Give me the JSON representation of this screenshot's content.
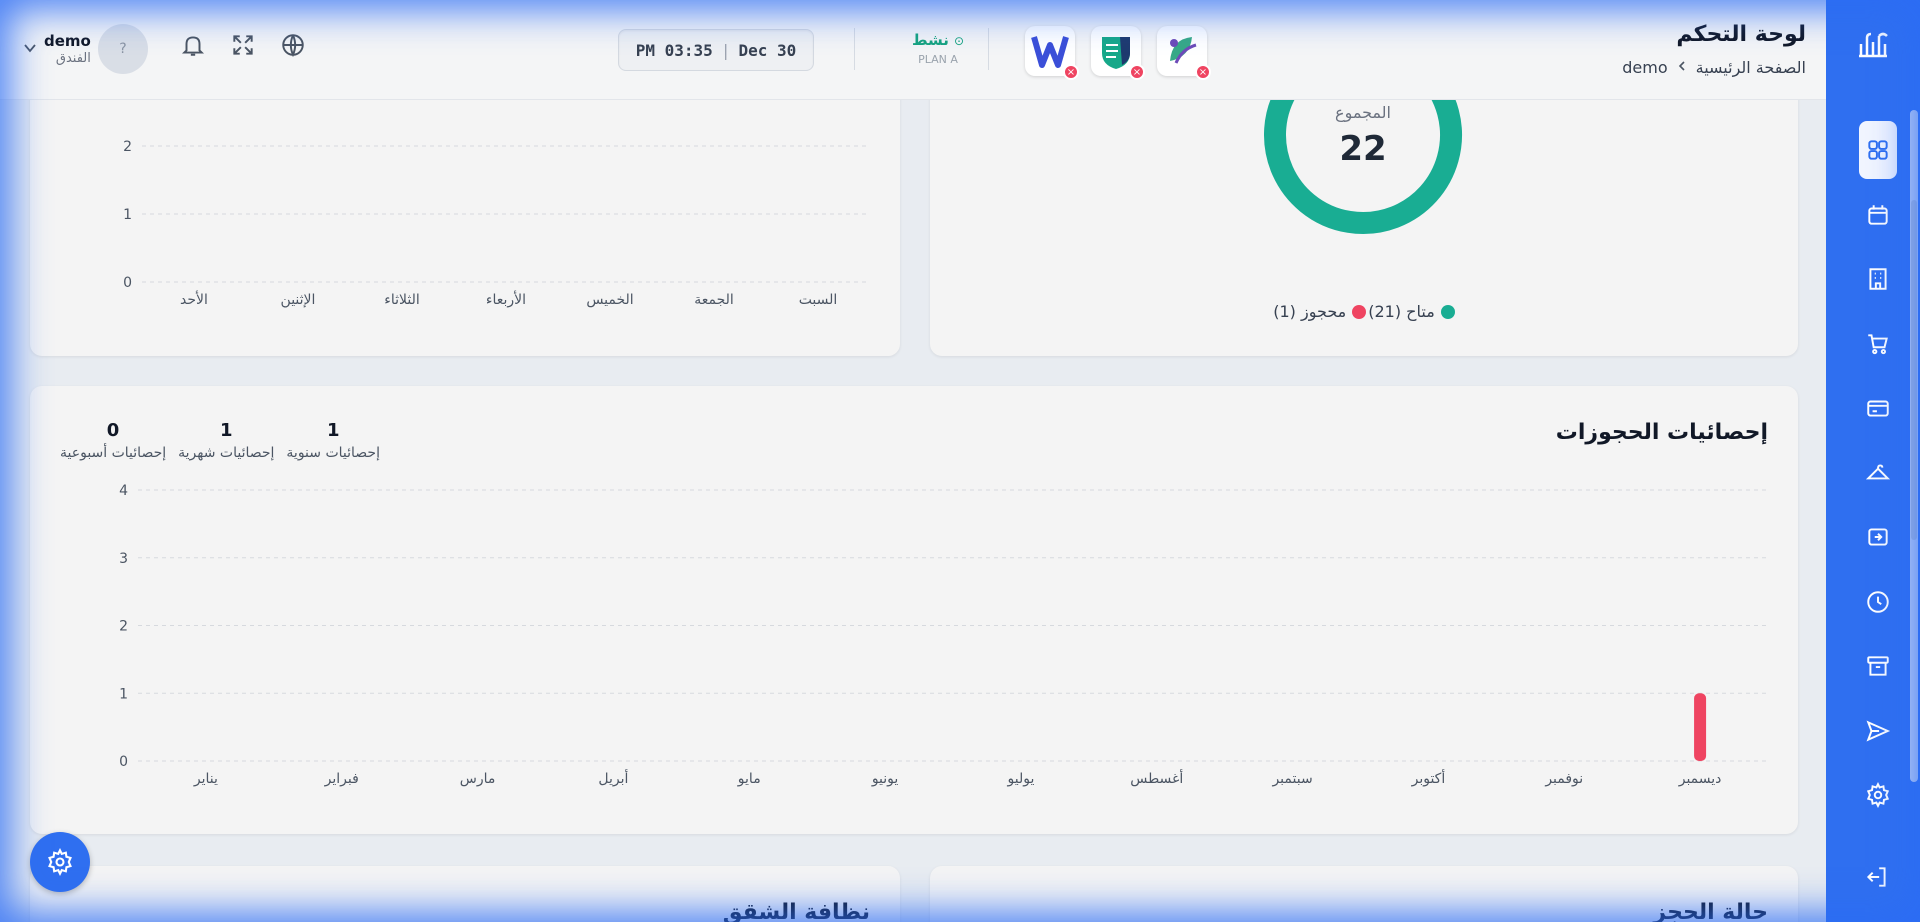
{
  "header": {
    "title": "لوحة التحكم",
    "breadcrumb": [
      "الصفحة الرئيسية",
      "demo"
    ],
    "status_label": "نشط",
    "plan": "PLAN A",
    "clock_time": "PM 03:35",
    "clock_date": "Dec 30",
    "avatar_glyph": "?",
    "user_name": "demo",
    "user_role": "الفندق",
    "app_icons": [
      "w-app-icon",
      "shield-app-icon",
      "leaf-app-icon"
    ]
  },
  "weekly_chart": {
    "chart_data": {
      "type": "bar",
      "categories": [
        "الأحد",
        "الإثنين",
        "الثلاثاء",
        "الأربعاء",
        "الخميس",
        "الجمعة",
        "السبت"
      ],
      "values": [
        0,
        0,
        0,
        0,
        0,
        0,
        0
      ],
      "y_ticks": [
        "0",
        "1",
        "2"
      ],
      "ylim": [
        0,
        2
      ],
      "grid": true
    }
  },
  "donut": {
    "center_label": "المجموع",
    "center_value": "22",
    "legend": [
      {
        "label": "متاح (21)",
        "color": "#19ad93"
      },
      {
        "label": "محجوز (1)",
        "color": "#ef4461"
      }
    ],
    "chart_data": {
      "type": "pie",
      "labels": [
        "متاح",
        "محجوز"
      ],
      "values": [
        21,
        1
      ],
      "colors": [
        "#19ad93",
        "#ef4461"
      ]
    }
  },
  "booking_stats": {
    "title": "إحصائيات الحجوزات",
    "kpis": [
      {
        "value": "1",
        "label": "إحصائيات سنوية"
      },
      {
        "value": "1",
        "label": "إحصائيات شهرية"
      },
      {
        "value": "0",
        "label": "إحصائيات أسبوعية"
      }
    ],
    "chart_data": {
      "type": "bar",
      "categories": [
        "يناير",
        "فبراير",
        "مارس",
        "أبريل",
        "مايو",
        "يونيو",
        "يوليو",
        "أغسطس",
        "سبتمبر",
        "أكتوبر",
        "نوفمبر",
        "ديسمبر"
      ],
      "values": [
        0,
        0,
        0,
        0,
        0,
        0,
        0,
        0,
        0,
        0,
        0,
        1
      ],
      "y_ticks": [
        "0",
        "1",
        "2",
        "3",
        "4"
      ],
      "ylim": [
        0,
        4
      ],
      "grid": true,
      "bar_color": "#ef4461"
    }
  },
  "bottom_cards": {
    "left_title": "نظافة الشقق",
    "right_title": "حالة الحجز"
  },
  "sidebar": {
    "items": [
      "dashboard-icon",
      "calendar-icon",
      "building-icon",
      "cart-icon",
      "credit-card-icon",
      "hanger-icon",
      "transfer-icon",
      "clock-icon",
      "archive-icon",
      "send-icon",
      "settings-icon"
    ],
    "logout": "logout-icon"
  },
  "colors": {
    "primary": "#2f6ff0",
    "available": "#19ad93",
    "booked": "#ef4461"
  }
}
